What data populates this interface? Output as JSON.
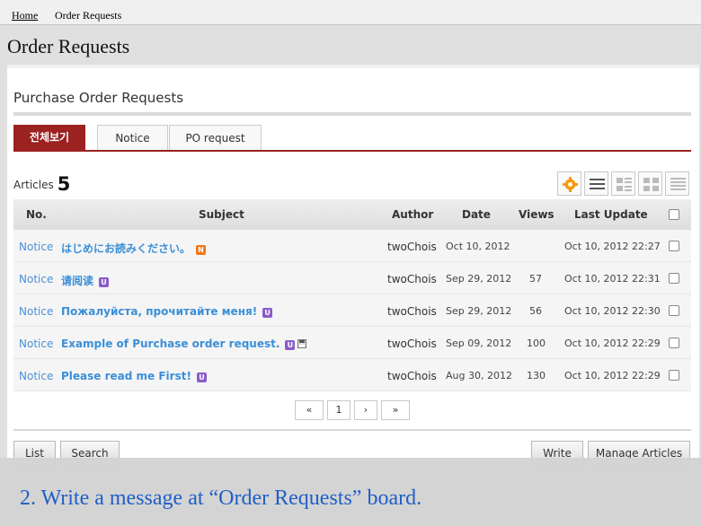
{
  "breadcrumb": {
    "home": "Home",
    "current": "Order Requests"
  },
  "page_title": "Order Requests",
  "section_title": "Purchase Order Requests",
  "tabs": [
    {
      "label": "전체보기",
      "active": true
    },
    {
      "label": "Notice",
      "active": false
    },
    {
      "label": "PO request",
      "active": false
    }
  ],
  "articles": {
    "label": "Articles",
    "count": "5"
  },
  "view_icons": [
    "gear-icon",
    "list-view-icon",
    "webzine-view-icon",
    "gallery-view-icon",
    "compact-list-icon"
  ],
  "table": {
    "headers": {
      "no": "No.",
      "subject": "Subject",
      "author": "Author",
      "date": "Date",
      "views": "Views",
      "last_update": "Last Update"
    },
    "rows": [
      {
        "no": "Notice",
        "subject": "はじめにお読みください。",
        "badge": "N",
        "author": "twoChois",
        "date": "Oct 10, 2012",
        "views": "",
        "last_update": "Oct 10, 2012 22:27"
      },
      {
        "no": "Notice",
        "subject": "请阅读",
        "badge": "U",
        "author": "twoChois",
        "date": "Sep 29, 2012",
        "views": "57",
        "last_update": "Oct 10, 2012 22:31"
      },
      {
        "no": "Notice",
        "subject": "Пожалуйста, прочитайте меня!",
        "badge": "U",
        "author": "twoChois",
        "date": "Sep 29, 2012",
        "views": "56",
        "last_update": "Oct 10, 2012 22:30"
      },
      {
        "no": "Notice",
        "subject": "Example of Purchase order request.",
        "badge": "U",
        "author": "twoChois",
        "date": "Sep 09, 2012",
        "views": "100",
        "last_update": "Oct 10, 2012 22:29"
      },
      {
        "no": "Notice",
        "subject": "Please read me First!",
        "badge": "U",
        "author": "twoChois",
        "date": "Aug 30, 2012",
        "views": "130",
        "last_update": "Oct 10, 2012 22:29"
      }
    ]
  },
  "pagination": {
    "first": "«",
    "page": "1",
    "next": "›",
    "last": "»"
  },
  "buttons": {
    "list": "List",
    "search": "Search",
    "write": "Write",
    "manage": "Manage Articles"
  },
  "caption": "2. Write a message at “Order Requests” board.",
  "colors": {
    "accent": "#9c2121",
    "link": "#3b8fd8",
    "caption": "#1e5fc8"
  }
}
